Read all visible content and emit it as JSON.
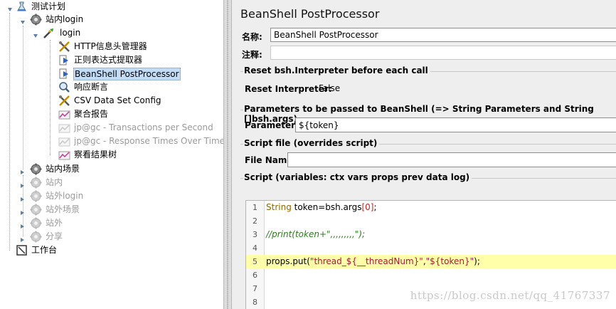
{
  "tree": {
    "items": [
      {
        "label": "测试计划",
        "icon": "test-plan-icon",
        "disabled": false
      },
      {
        "label": "站内login",
        "icon": "thread-group-icon",
        "disabled": false
      },
      {
        "label": "login",
        "icon": "sampler-icon",
        "disabled": false
      },
      {
        "label": "HTTP信息头管理器",
        "icon": "config-element-icon",
        "disabled": false
      },
      {
        "label": "正则表达式提取器",
        "icon": "post-processor-icon",
        "disabled": false
      },
      {
        "label": "BeanShell PostProcessor",
        "icon": "post-processor-icon",
        "disabled": false,
        "selected": true
      },
      {
        "label": "响应断言",
        "icon": "assertion-icon",
        "disabled": false
      },
      {
        "label": "CSV Data Set Config",
        "icon": "config-element-icon",
        "disabled": false
      },
      {
        "label": "聚合报告",
        "icon": "listener-icon",
        "disabled": false
      },
      {
        "label": "jp@gc - Transactions per Second",
        "icon": "listener-icon",
        "disabled": true
      },
      {
        "label": "jp@gc - Response Times Over Time",
        "icon": "listener-icon",
        "disabled": true
      },
      {
        "label": "察看结果树",
        "icon": "listener-icon",
        "disabled": false
      },
      {
        "label": "站内场景",
        "icon": "thread-group-icon",
        "disabled": false
      },
      {
        "label": "站内",
        "icon": "thread-group-icon",
        "disabled": true
      },
      {
        "label": "站外login",
        "icon": "thread-group-icon",
        "disabled": true
      },
      {
        "label": "站外场景",
        "icon": "thread-group-icon",
        "disabled": true
      },
      {
        "label": "站外",
        "icon": "thread-group-icon",
        "disabled": true
      },
      {
        "label": "分享",
        "icon": "thread-group-icon",
        "disabled": true
      },
      {
        "label": "工作台",
        "icon": "workbench-icon",
        "disabled": false
      }
    ]
  },
  "panel": {
    "title": "BeanShell PostProcessor",
    "name_label": "名称:",
    "name_value": "BeanShell PostProcessor",
    "comment_label": "注释:",
    "comment_value": "",
    "reset_group": {
      "title": "Reset bsh.Interpreter before each call",
      "label": "Reset Interpreter:",
      "value": "False"
    },
    "params_group": {
      "title": "Parameters to be passed to BeanShell (=> String Parameters and String []bsh.args)",
      "label": "Parameters:",
      "value": "${token}"
    },
    "script_file_group": {
      "title": "Script file (overrides script)",
      "label": "File Name:",
      "value": ""
    },
    "script_group": {
      "title": "Script (variables: ctx vars props prev data log)"
    }
  },
  "editor": {
    "line_numbers": [
      "1",
      "2",
      "3",
      "4",
      "5",
      "6",
      "7",
      "8"
    ],
    "lines": [
      {
        "tokens": [
          [
            "String",
            "type"
          ],
          [
            " token=bsh.args",
            "plain"
          ],
          [
            "[0]",
            "num"
          ],
          [
            ";",
            "plain"
          ]
        ]
      },
      {
        "tokens": []
      },
      {
        "tokens": [
          [
            "//print(token+\",,,,,,,,,\");",
            "cmt"
          ]
        ]
      },
      {
        "tokens": []
      },
      {
        "tokens": [
          [
            "props.put(",
            "plain"
          ],
          [
            "\"thread_${__threadNum}\"",
            "str"
          ],
          [
            ",",
            "plain"
          ],
          [
            "\"${token}\"",
            "str"
          ],
          [
            ");",
            "plain"
          ]
        ],
        "highlight": true
      },
      {
        "tokens": []
      },
      {
        "tokens": []
      },
      {
        "tokens": []
      }
    ]
  },
  "watermark": "https://blog.csdn.net/qq_41767337",
  "colors": {
    "selection": "#c3dcf5",
    "current_line": "#ffffaa",
    "panel_bg": "#eeeeee"
  }
}
